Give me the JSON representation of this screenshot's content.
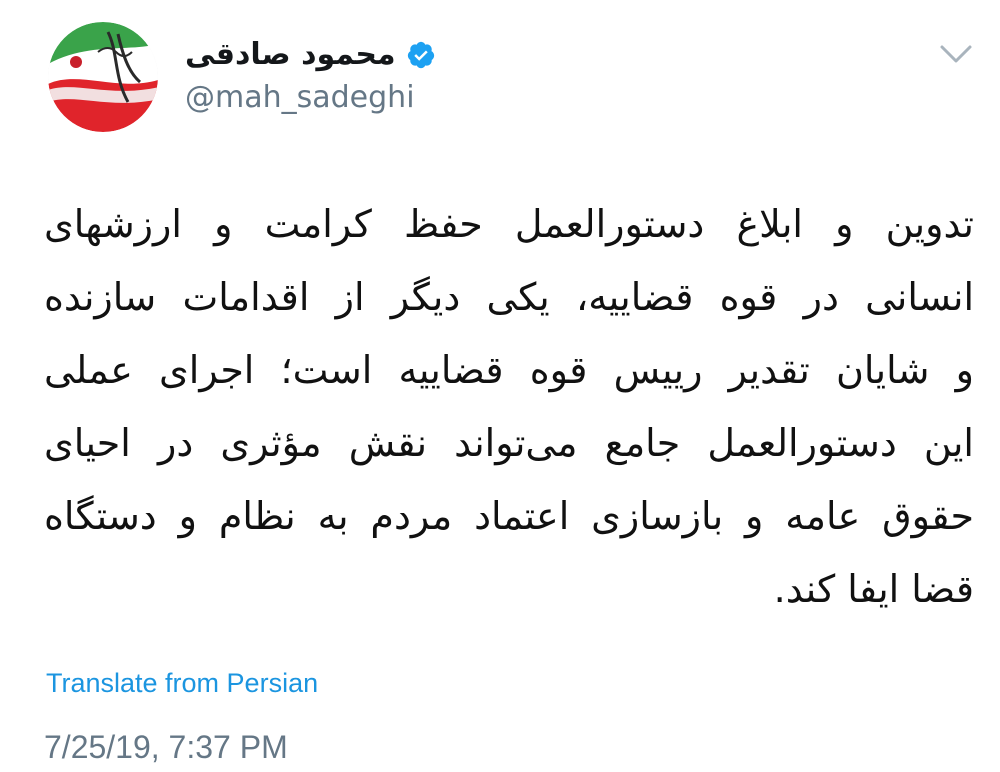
{
  "author": {
    "display_name": "محمود صادقی",
    "handle": "@mah_sadeghi",
    "verified": true,
    "avatar_icon": "iran-flag-avatar-icon"
  },
  "tweet": {
    "lines": [
      "تدوین و ابلاغ دستورالعمل حفظ کرامت و ارزشهای",
      "انسانی در قوه قضاییه، یکی دیگر از اقدامات سازنده",
      "و شایان تقدیر رییس قوه قضاییه است؛ اجرای عملی",
      "این دستورالعمل جامع می‌تواند نقش مؤثری در احیای",
      "حقوق عامه و بازسازی اعتماد مردم به نظام و دستگاه",
      "قضا ایفا کند."
    ]
  },
  "actions": {
    "translate_label": "Translate from Persian",
    "menu_icon": "chevron-down-icon"
  },
  "meta": {
    "timestamp": "7/25/19, 7:37 PM"
  },
  "colors": {
    "link": "#1b95e0",
    "muted": "#657786",
    "verified": "#1da1f2",
    "text": "#14171a"
  }
}
